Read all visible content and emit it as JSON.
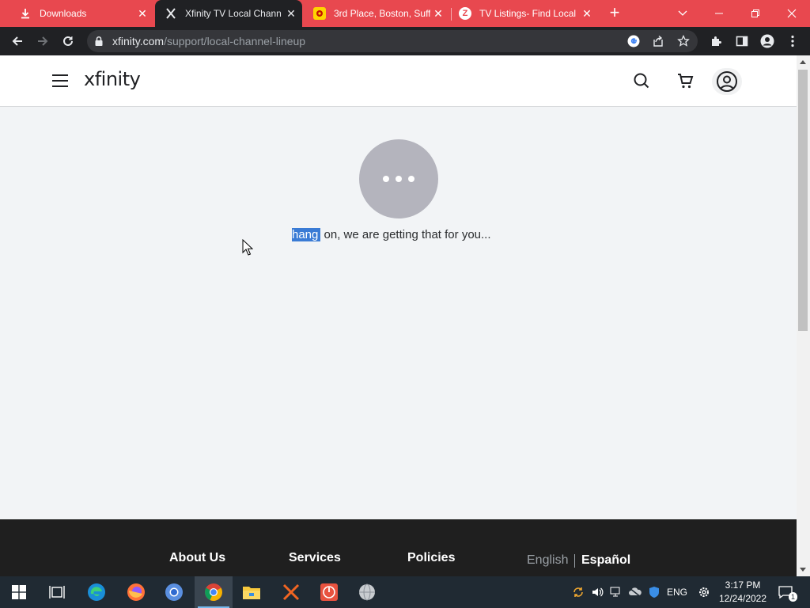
{
  "browser": {
    "tabs": [
      {
        "title": "Downloads",
        "icon": "download-icon",
        "active": false
      },
      {
        "title": "Xfinity TV Local Channe",
        "icon": "xfinity-x-icon",
        "active": true
      },
      {
        "title": "3rd Place, Boston, Suff",
        "icon": "yelp-icon",
        "active": false
      },
      {
        "title": "TV Listings- Find Local",
        "icon": "zap2it-icon",
        "active": false
      }
    ],
    "address": {
      "host": "xfinity.com",
      "path": "/support/local-channel-lineup"
    }
  },
  "site": {
    "logo_text": "xfinity",
    "loading": {
      "highlighted_word": "hang",
      "rest_text": " on, we are getting that for you..."
    },
    "footer": {
      "nav": [
        "About Us",
        "Services",
        "Policies"
      ],
      "lang_english": "English",
      "lang_spanish": "Español"
    }
  },
  "taskbar": {
    "apps": [
      "windows-start-icon",
      "task-view-icon",
      "edge-icon",
      "firefox-icon",
      "chromium-icon",
      "chrome-icon",
      "file-explorer-icon",
      "app-x-icon",
      "app-power-icon",
      "app-globe-icon"
    ],
    "language": "ENG",
    "time": "3:17 PM",
    "date": "12/24/2022",
    "notification_count": "1"
  },
  "colors": {
    "tab_strip": "#e8484f",
    "toolbar": "#202124",
    "page_bg": "#f2f4f6",
    "footer_bg": "#1f1f1f",
    "selection": "#3a7bd5",
    "taskbar": "#202a33"
  }
}
